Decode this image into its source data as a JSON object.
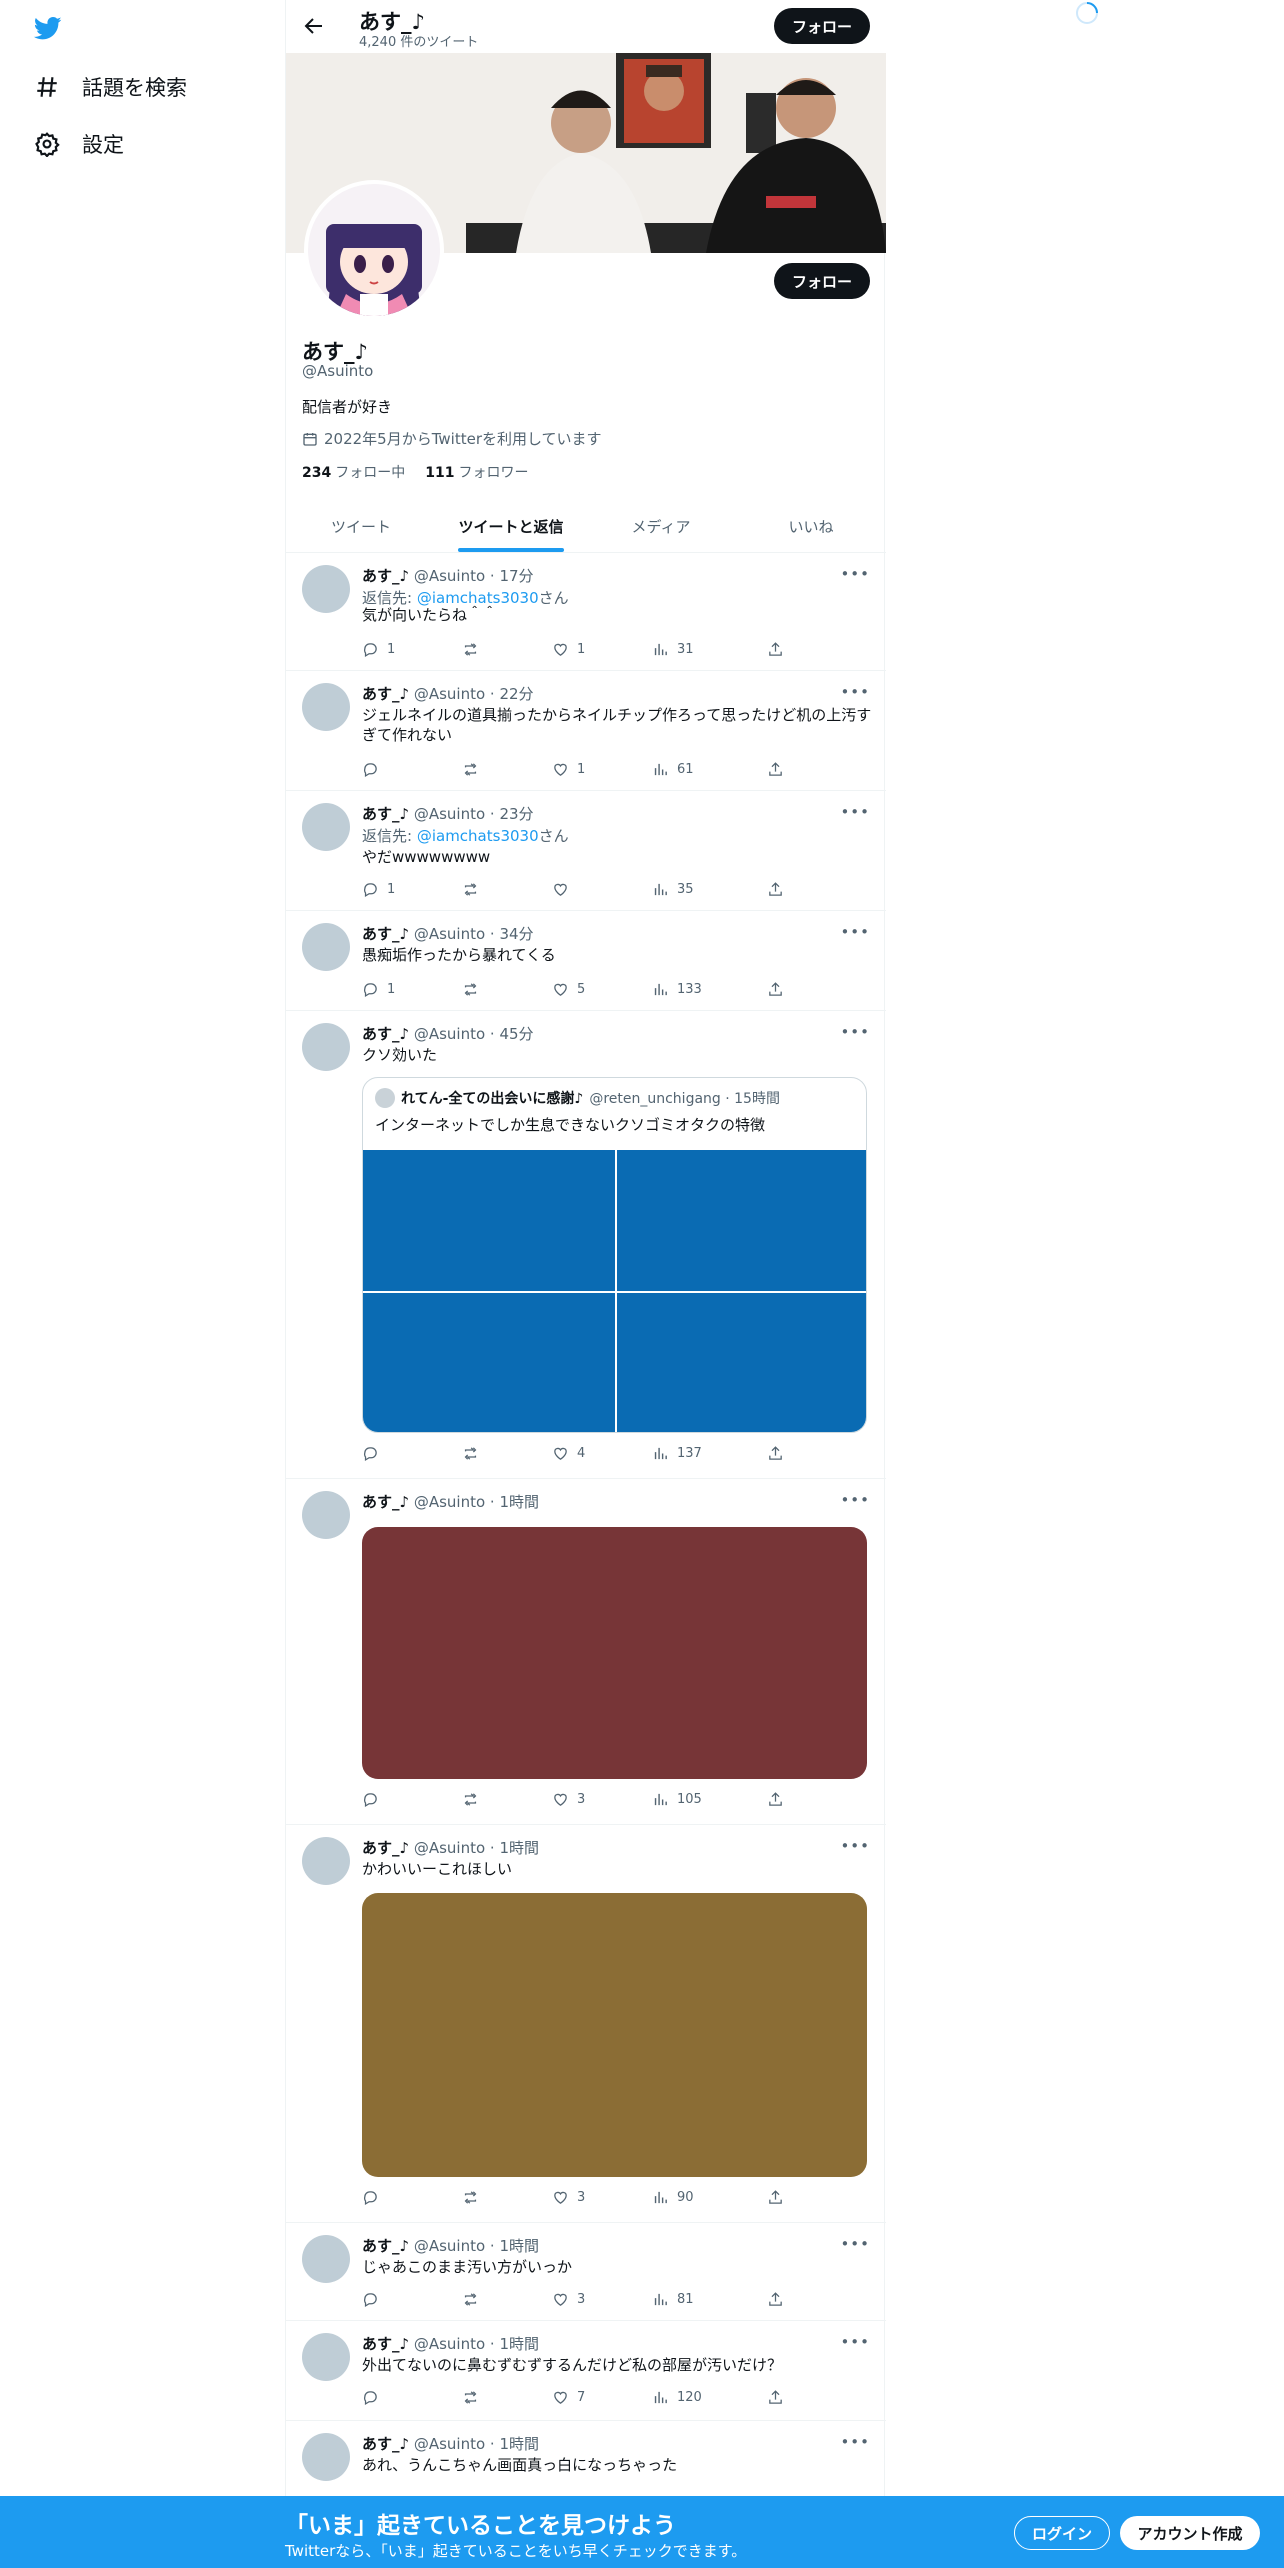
{
  "nav": {
    "explore_label": "話題を検索",
    "settings_label": "設定"
  },
  "header": {
    "name": "あす_♪",
    "tweet_count": "4,240 件のツイート",
    "follow_label": "フォロー"
  },
  "profile": {
    "name": "あす_♪",
    "handle": "@Asuinto",
    "bio": "配信者が好き",
    "joined": "2022年5月からTwitterを利用しています",
    "following_count": "234",
    "following_label": "フォロー中",
    "followers_count": "111",
    "followers_label": "フォロワー",
    "follow_label": "フォロー"
  },
  "tabs": [
    {
      "label": "ツイート"
    },
    {
      "label": "ツイートと返信"
    },
    {
      "label": "メディア"
    },
    {
      "label": "いいね"
    }
  ],
  "tweets": [
    {
      "name": "あす_♪",
      "handle": "@Asuinto",
      "time": "17分",
      "reply_prefix": "返信先: ",
      "reply_to": "@iamchats3030",
      "reply_suffix": "さん",
      "text": "気が向いたらね＾＾",
      "replies": "1",
      "retweets": "",
      "likes": "1",
      "views": "31"
    },
    {
      "name": "あす_♪",
      "handle": "@Asuinto",
      "time": "22分",
      "text": "ジェルネイルの道具揃ったからネイルチップ作ろって思ったけど机の上汚すぎて作れない",
      "replies": "",
      "retweets": "",
      "likes": "1",
      "views": "61"
    },
    {
      "name": "あす_♪",
      "handle": "@Asuinto",
      "time": "23分",
      "reply_prefix": "返信先: ",
      "reply_to": "@iamchats3030",
      "reply_suffix": "さん",
      "text": "やだwwwwwwww",
      "replies": "1",
      "retweets": "",
      "likes": "",
      "views": "35"
    },
    {
      "name": "あす_♪",
      "handle": "@Asuinto",
      "time": "34分",
      "text": "愚痴垢作ったから暴れてくる",
      "replies": "1",
      "retweets": "",
      "likes": "5",
      "views": "133"
    },
    {
      "name": "あす_♪",
      "handle": "@Asuinto",
      "time": "45分",
      "text": "クソ効いた",
      "replies": "",
      "retweets": "",
      "likes": "4",
      "views": "137",
      "quote": {
        "name": "れてん-全ての出会いに感謝♪",
        "handle": "@reten_unchigang",
        "time": "15時間",
        "text": "インターネットでしか生息できないクソゴミオタクの特徴",
        "media_color": "#0a6bb3"
      }
    },
    {
      "name": "あす_♪",
      "handle": "@Asuinto",
      "time": "1時間",
      "text": "",
      "replies": "",
      "retweets": "",
      "likes": "3",
      "views": "105",
      "media_color": "#773537"
    },
    {
      "name": "あす_♪",
      "handle": "@Asuinto",
      "time": "1時間",
      "text": "かわいいーこれほしい",
      "replies": "",
      "retweets": "",
      "likes": "3",
      "views": "90",
      "media_color": "#8b6d35"
    },
    {
      "name": "あす_♪",
      "handle": "@Asuinto",
      "time": "1時間",
      "text": "じゃあこのまま汚い方がいっか",
      "replies": "",
      "retweets": "",
      "likes": "3",
      "views": "81"
    },
    {
      "name": "あす_♪",
      "handle": "@Asuinto",
      "time": "1時間",
      "text": "外出てないのに鼻むずむずするんだけど私の部屋が汚いだけ？",
      "replies": "",
      "retweets": "",
      "likes": "7",
      "views": "120"
    },
    {
      "name": "あす_♪",
      "handle": "@Asuinto",
      "time": "1時間",
      "text": "あれ、うんこちゃん画面真っ白になっちゃった"
    }
  ],
  "bottom_bar": {
    "title": "「いま」起きていることを見つけよう",
    "subtitle": "Twitterなら、「いま」起きていることをいち早くチェックできます。",
    "login_label": "ログイン",
    "signup_label": "アカウント作成"
  },
  "colors": {
    "accent": "#1d9bf0",
    "text": "#0f1419",
    "muted": "#536471"
  }
}
